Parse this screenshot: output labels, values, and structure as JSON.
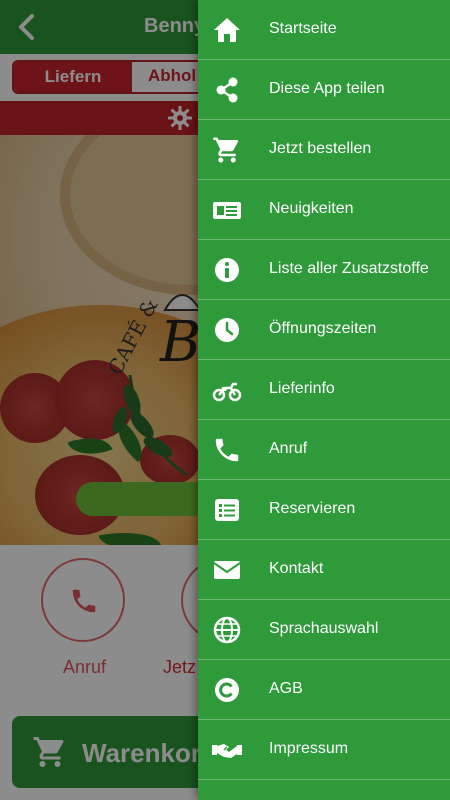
{
  "app": {
    "title": "Benny's",
    "tabs": {
      "delivery": "Liefern",
      "pickup": "Abhol"
    },
    "hero_logo_text": "Be",
    "actions": {
      "call": "Anruf",
      "order": "Jetz"
    },
    "cart_label": "Warenkorb"
  },
  "drawer": {
    "items": [
      {
        "label": "Startseite",
        "icon": "home-icon"
      },
      {
        "label": "Diese App teilen",
        "icon": "share-icon"
      },
      {
        "label": "Jetzt bestellen",
        "icon": "cart-icon"
      },
      {
        "label": "Neuigkeiten",
        "icon": "newspaper-icon"
      },
      {
        "label": "Liste aller Zusatzstoffe",
        "icon": "info-icon"
      },
      {
        "label": "Öffnungszeiten",
        "icon": "clock-icon"
      },
      {
        "label": "Lieferinfo",
        "icon": "motorcycle-icon"
      },
      {
        "label": "Anruf",
        "icon": "phone-icon"
      },
      {
        "label": "Reservieren",
        "icon": "list-icon"
      },
      {
        "label": "Kontakt",
        "icon": "envelope-icon"
      },
      {
        "label": "Sprachauswahl",
        "icon": "globe-icon"
      },
      {
        "label": "AGB",
        "icon": "copyright-icon"
      },
      {
        "label": "Impressum",
        "icon": "handshake-icon"
      }
    ]
  },
  "colors": {
    "brand_green": "#2e9a3a",
    "brand_red": "#c1242b",
    "accent_light_green": "#6ec039"
  }
}
